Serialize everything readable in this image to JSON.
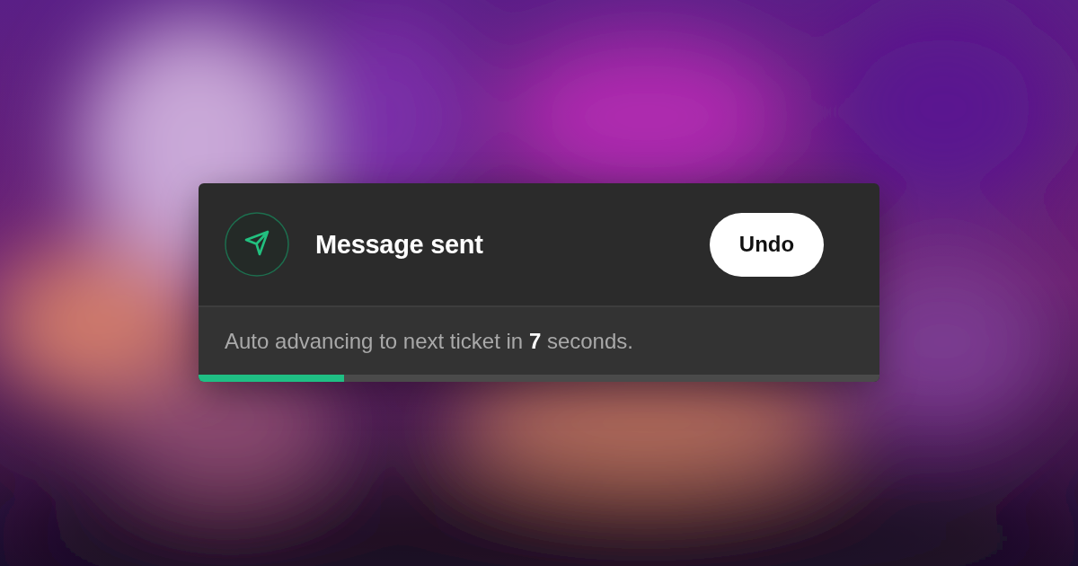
{
  "toast": {
    "title": "Message sent",
    "action": "Undo",
    "message": "Auto advancing to next ticket in **7** seconds.",
    "progress": {
      "level": 0.214
    }
  }
}
